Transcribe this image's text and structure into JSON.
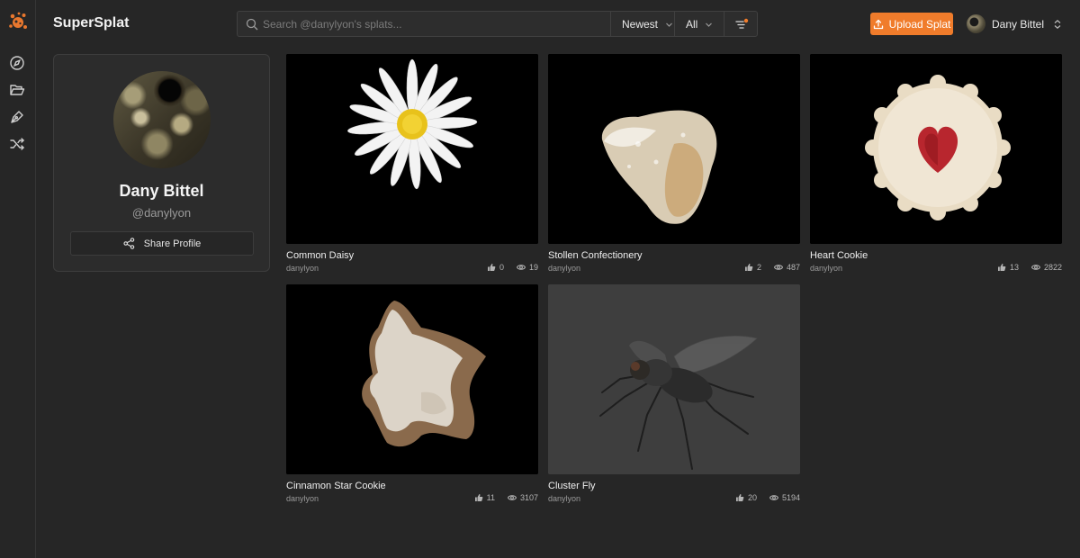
{
  "app": {
    "title": "SuperSplat"
  },
  "search": {
    "placeholder": "Search @danylyon's splats...",
    "value": ""
  },
  "filters": {
    "sort": "Newest",
    "scope": "All"
  },
  "header": {
    "upload_label": "Upload Splat",
    "user_name": "Dany Bittel"
  },
  "profile": {
    "name": "Dany Bittel",
    "handle": "@danylyon",
    "share_label": "Share Profile"
  },
  "colors": {
    "accent": "#f07c2b",
    "background": "#262626",
    "card": "#2c2c2c"
  },
  "splats": [
    {
      "title": "Common Daisy",
      "author": "danylyon",
      "likes": "0",
      "views": "19"
    },
    {
      "title": "Stollen Confectionery",
      "author": "danylyon",
      "likes": "2",
      "views": "487"
    },
    {
      "title": "Heart Cookie",
      "author": "danylyon",
      "likes": "13",
      "views": "2822"
    },
    {
      "title": "Cinnamon Star Cookie",
      "author": "danylyon",
      "likes": "11",
      "views": "3107"
    },
    {
      "title": "Cluster Fly",
      "author": "danylyon",
      "likes": "20",
      "views": "5194"
    }
  ]
}
